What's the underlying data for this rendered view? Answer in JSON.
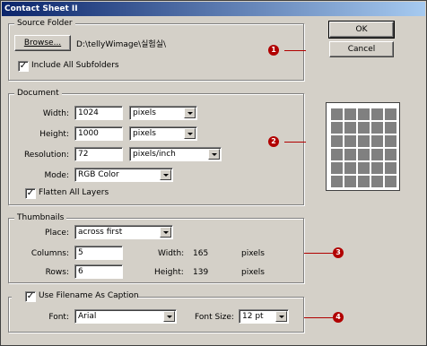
{
  "window": {
    "title": "Contact Sheet II"
  },
  "buttons": {
    "ok": "OK",
    "cancel": "Cancel",
    "browse": "Browse..."
  },
  "source_folder": {
    "group_label": "Source Folder",
    "path": "D:\\tellyWimage\\실험실\\",
    "include_subfolders": {
      "label": "Include All Subfolders",
      "checked": true
    }
  },
  "document": {
    "group_label": "Document",
    "width": {
      "label": "Width:",
      "value": "1024",
      "unit": "pixels"
    },
    "height": {
      "label": "Height:",
      "value": "1000",
      "unit": "pixels"
    },
    "resolution": {
      "label": "Resolution:",
      "value": "72",
      "unit": "pixels/inch"
    },
    "mode": {
      "label": "Mode:",
      "value": "RGB Color"
    },
    "flatten": {
      "label": "Flatten All Layers",
      "checked": true
    }
  },
  "thumbnails": {
    "group_label": "Thumbnails",
    "place": {
      "label": "Place:",
      "value": "across first"
    },
    "columns": {
      "label": "Columns:",
      "value": "5"
    },
    "rows": {
      "label": "Rows:",
      "value": "6"
    },
    "thumb_width": {
      "label": "Width:",
      "value": "165",
      "unit": "pixels"
    },
    "thumb_height": {
      "label": "Height:",
      "value": "139",
      "unit": "pixels"
    }
  },
  "caption": {
    "use_filename": {
      "label": "Use Filename As Caption",
      "checked": true
    },
    "font": {
      "label": "Font:",
      "value": "Arial"
    },
    "font_size": {
      "label": "Font Size:",
      "value": "12 pt"
    }
  },
  "markers": [
    "1",
    "2",
    "3",
    "4"
  ],
  "colors": {
    "titlebar": "#0a246a",
    "marker": "#b10000",
    "face": "#d4d0c8"
  }
}
